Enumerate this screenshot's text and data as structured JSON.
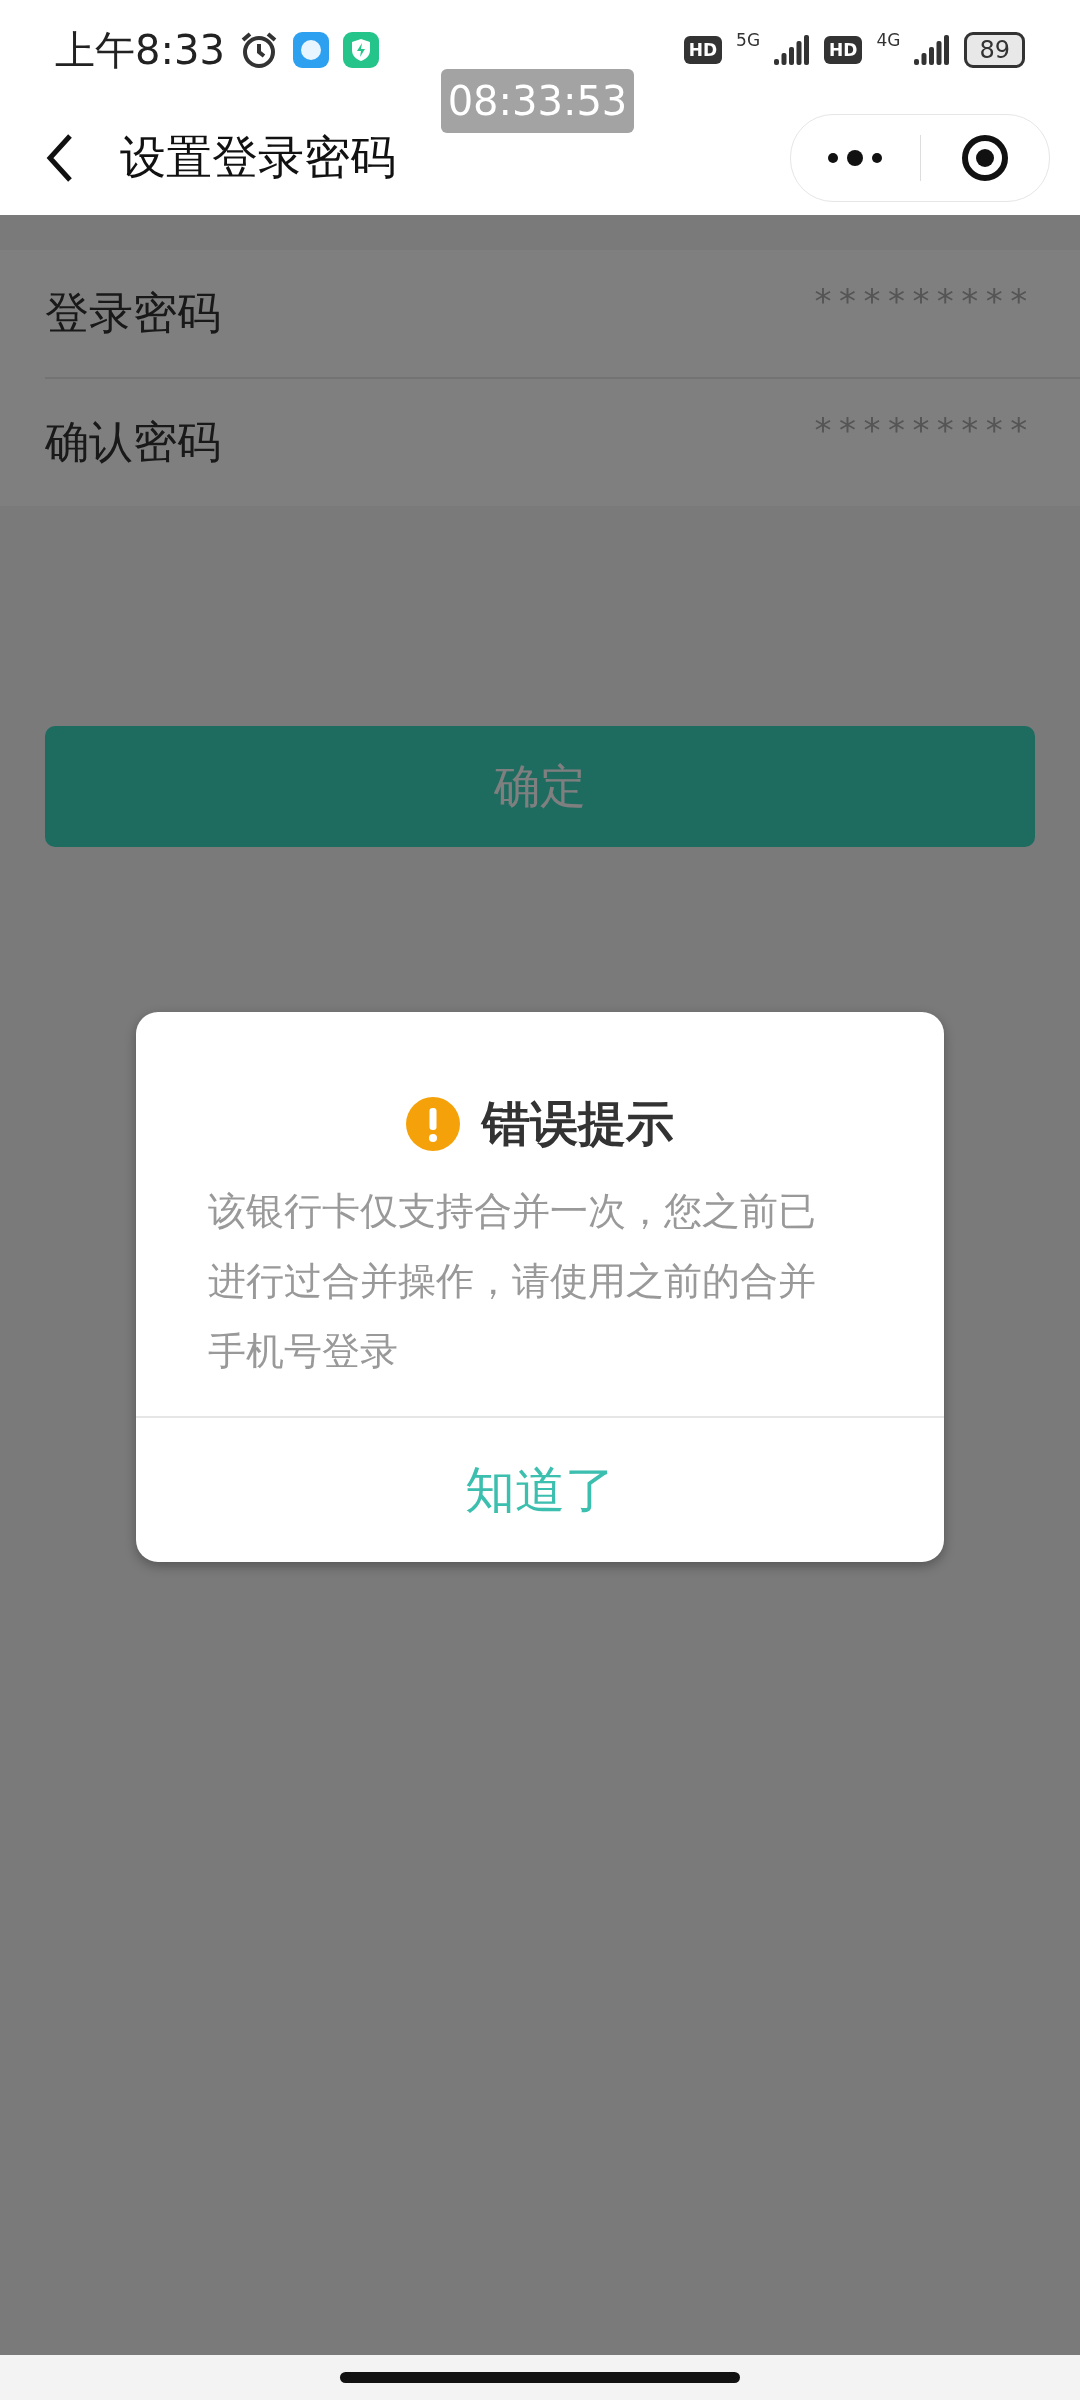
{
  "status_bar": {
    "time": "上午8:33",
    "indicators": [
      {
        "badge": "HD",
        "network": "5G"
      },
      {
        "badge": "HD",
        "network": "4G"
      }
    ],
    "battery": "89"
  },
  "time_overlay": "08:33:53",
  "nav": {
    "title": "设置登录密码"
  },
  "form": {
    "fields": [
      {
        "label": "登录密码",
        "placeholder": "*********"
      },
      {
        "label": "确认密码",
        "placeholder": "*********"
      }
    ]
  },
  "confirm_button": "确定",
  "dialog": {
    "title": "错误提示",
    "message": "该银行卡仅支持合并一次，您之前已进行过合并操作，请使用之前的合并手机号登录",
    "button": "知道了"
  }
}
